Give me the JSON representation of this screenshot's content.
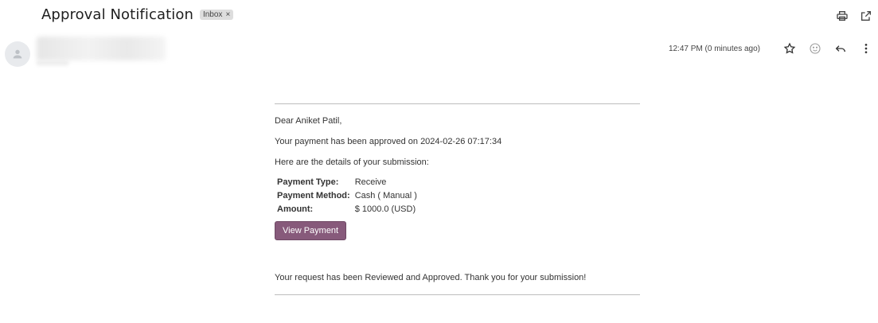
{
  "email": {
    "subject": "Approval Notification",
    "label": "Inbox",
    "label_remove": "×",
    "timestamp": "12:47 PM (0 minutes ago)",
    "top_icons": [
      "print-icon",
      "open-in-new-window-icon"
    ],
    "meta_icons": [
      "star-icon",
      "emoji-react-icon",
      "reply-icon",
      "more-options-icon"
    ]
  },
  "body": {
    "greeting": "Dear Aniket Patil,",
    "approval_line": "Your payment has been approved on 2024-02-26 07:17:34",
    "details_intro": "Here are the details of your submission:",
    "details": [
      {
        "key": "Payment Type:",
        "value": "Receive"
      },
      {
        "key": "Payment Method:",
        "value": "Cash ( Manual )"
      },
      {
        "key": "Amount:",
        "value": "$ 1000.0 (USD)"
      }
    ],
    "button_label": "View Payment",
    "closing": "Your request has been Reviewed and Approved. Thank you for your submission!"
  },
  "colors": {
    "button": "#875a7b",
    "chip": "#dddddd"
  }
}
